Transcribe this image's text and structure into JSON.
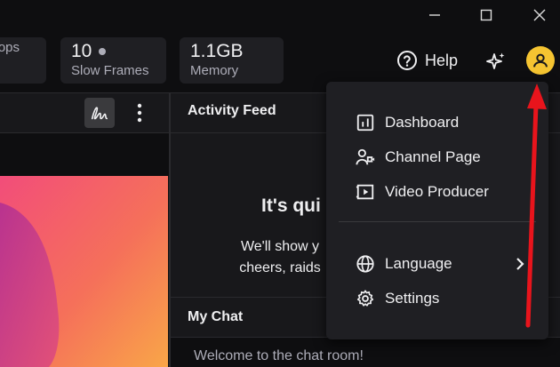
{
  "window_controls": {
    "minimize": "minimize",
    "maximize": "maximize",
    "close": "close"
  },
  "stats": [
    {
      "value": "",
      "label": "Drops"
    },
    {
      "value": "10",
      "label": "Slow Frames"
    },
    {
      "value": "1.1GB",
      "label": "Memory"
    }
  ],
  "header_actions": {
    "help_label": "Help"
  },
  "activity_feed": {
    "title": "Activity Feed",
    "empty_title": "It's qui",
    "empty_body_line1": "We'll show y",
    "empty_body_line2": "cheers, raids"
  },
  "chat": {
    "title": "My Chat",
    "welcome": "Welcome to the chat room!"
  },
  "user_menu": {
    "items": [
      {
        "label": "Dashboard",
        "icon": "dashboard-icon"
      },
      {
        "label": "Channel Page",
        "icon": "channel-page-icon"
      },
      {
        "label": "Video Producer",
        "icon": "video-producer-icon"
      },
      {
        "label": "Language",
        "icon": "globe-icon"
      },
      {
        "label": "Settings",
        "icon": "gear-icon"
      }
    ]
  },
  "colors": {
    "background": "#0e0e10",
    "panel": "#18181b",
    "menu": "#1f1f23",
    "avatar": "#f5c431",
    "annotation_arrow": "#e8141c"
  }
}
